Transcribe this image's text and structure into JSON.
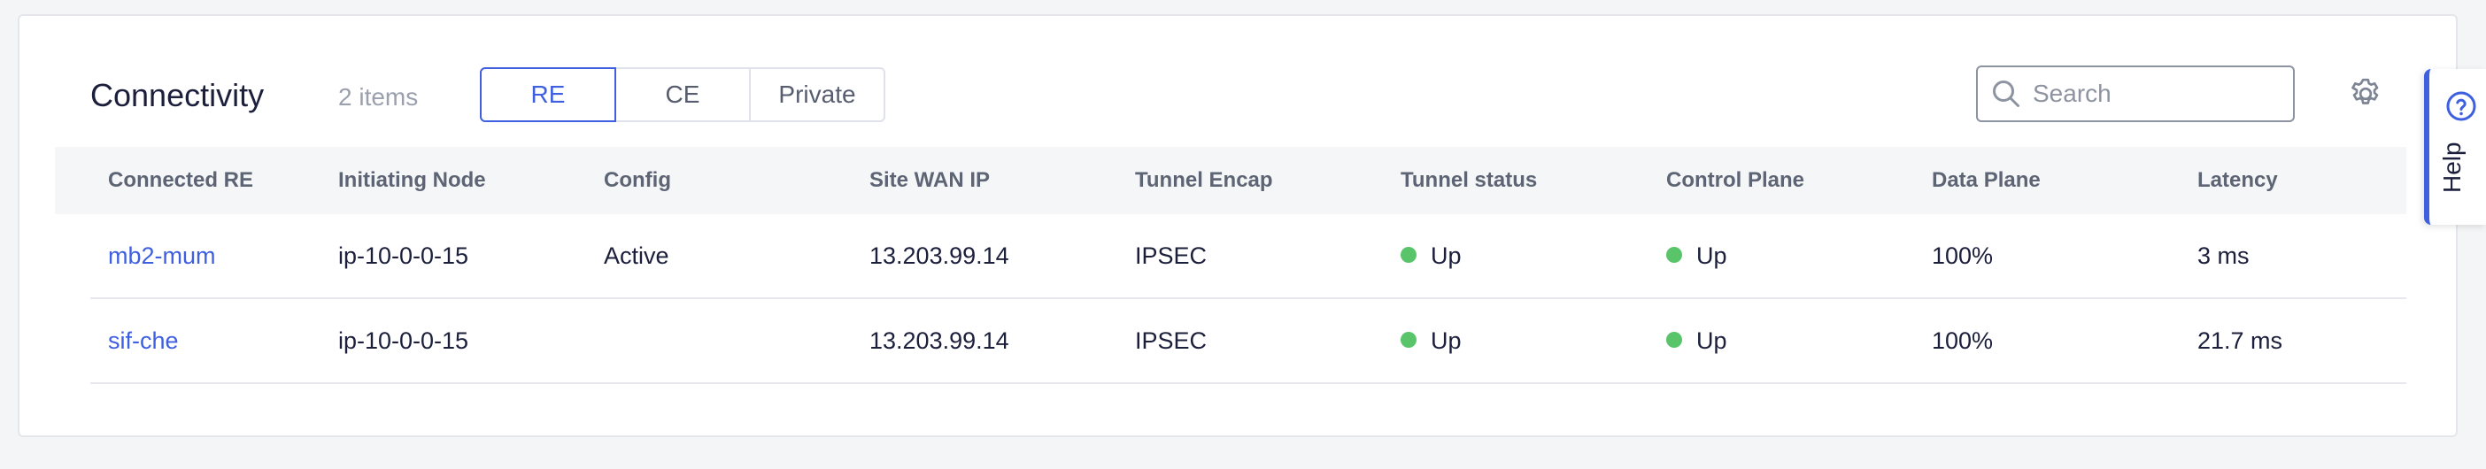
{
  "header": {
    "title": "Connectivity",
    "count": "2 items",
    "tabs": [
      {
        "label": "RE",
        "active": true
      },
      {
        "label": "CE",
        "active": false
      },
      {
        "label": "Private",
        "active": false
      }
    ],
    "search": {
      "placeholder": "Search",
      "value": "",
      "icon": "search-icon"
    },
    "settings_icon": "gear-icon"
  },
  "table": {
    "columns": [
      "Connected RE",
      "Initiating Node",
      "Config",
      "Site WAN IP",
      "Tunnel Encap",
      "Tunnel status",
      "Control Plane",
      "Data Plane",
      "Latency"
    ],
    "rows": [
      {
        "connected_re": "mb2-mum",
        "initiating_node": "ip-10-0-0-15",
        "config": "Active",
        "site_wan_ip": "13.203.99.14",
        "tunnel_encap": "IPSEC",
        "tunnel_status": "Up",
        "control_plane": "Up",
        "data_plane": "100%",
        "latency": "3 ms"
      },
      {
        "connected_re": "sif-che",
        "initiating_node": "ip-10-0-0-15",
        "config": "",
        "site_wan_ip": "13.203.99.14",
        "tunnel_encap": "IPSEC",
        "tunnel_status": "Up",
        "control_plane": "Up",
        "data_plane": "100%",
        "latency": "21.7 ms"
      }
    ]
  },
  "help": {
    "label": "Help",
    "icon": "question-circle-icon"
  },
  "colors": {
    "accent": "#3e5fe0",
    "status_up": "#5ac46b"
  }
}
